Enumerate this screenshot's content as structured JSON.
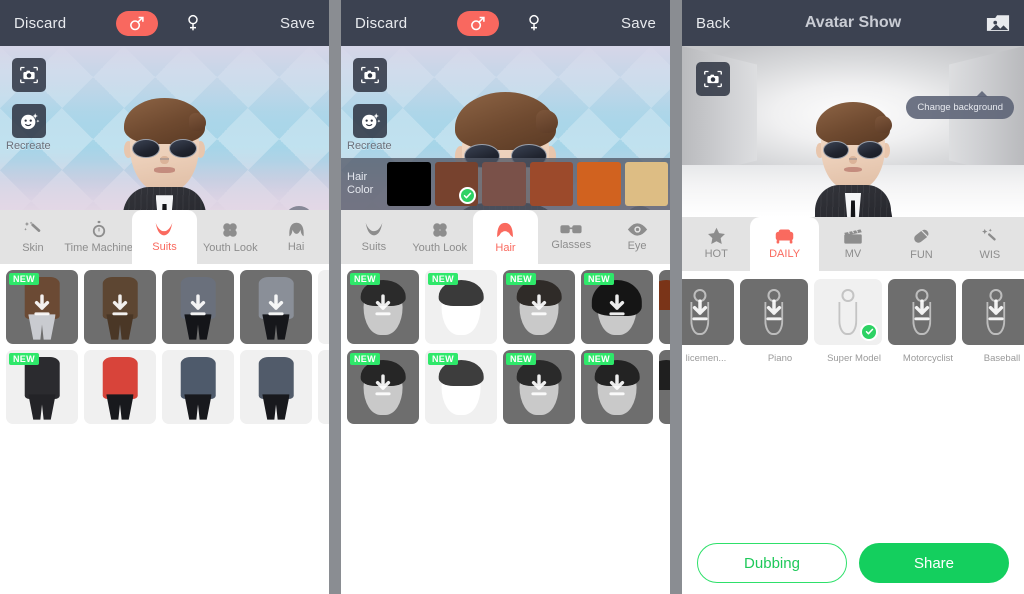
{
  "panel1": {
    "header": {
      "discard": "Discard",
      "save": "Save",
      "male_icon": "male-symbol-icon",
      "female_icon": "female-symbol-icon",
      "male_selected": true,
      "accent": "#f9685f"
    },
    "stage": {
      "camera_icon": "camera-icon",
      "recreate_icon": "face-sparkle-icon",
      "recreate_label": "Recreate",
      "zoom_in": "+",
      "zoom_out": "−",
      "background": "argyle-light-blue"
    },
    "tabs": [
      {
        "label": "Skin",
        "icon": "magic-wand-icon",
        "active": false
      },
      {
        "label": "Time Machine",
        "icon": "stopwatch-icon",
        "active": false
      },
      {
        "label": "Suits",
        "icon": "suit-icon",
        "active": true
      },
      {
        "label": "Youth Look",
        "icon": "clover-icon",
        "active": false
      },
      {
        "label": "Hai",
        "icon": "hair-icon",
        "active": false
      }
    ],
    "grid_rows": [
      [
        {
          "badge": "NEW",
          "dark": true,
          "download": true,
          "color": "#6b4a34"
        },
        {
          "badge": "",
          "dark": true,
          "download": true,
          "color": "#5d4632"
        },
        {
          "badge": "",
          "dark": true,
          "download": true,
          "color": "#6a707c"
        },
        {
          "badge": "",
          "dark": true,
          "download": true,
          "color": "#8a8f98"
        },
        {
          "badge": "",
          "dark": true,
          "download": true,
          "color": "#7b7f88"
        }
      ],
      [
        {
          "badge": "NEW",
          "dark": false,
          "download": false,
          "color": "#2b2b2f"
        },
        {
          "badge": "",
          "dark": false,
          "download": false,
          "color": "#d8443a"
        },
        {
          "badge": "",
          "dark": false,
          "download": false,
          "color": "#4e5a6b"
        },
        {
          "badge": "",
          "dark": false,
          "download": false,
          "color": "#515b6a"
        },
        {
          "badge": "",
          "dark": false,
          "download": false,
          "color": "#4a5565"
        }
      ]
    ]
  },
  "panel2": {
    "header": {
      "discard": "Discard",
      "save": "Save",
      "male_icon": "male-symbol-icon",
      "female_icon": "female-symbol-icon",
      "male_selected": true,
      "accent": "#f9685f"
    },
    "stage": {
      "camera_icon": "camera-icon",
      "recreate_icon": "face-sparkle-icon",
      "recreate_label": "Recreate",
      "zoom_in": "+",
      "zoom_out": "−",
      "background": "argyle-light-blue"
    },
    "hair_color": {
      "label": "Hair\nColor",
      "label_line1": "Hair",
      "label_line2": "Color",
      "swatches": [
        {
          "color": "#000000",
          "selected": false
        },
        {
          "color": "#77422e",
          "selected": true
        },
        {
          "color": "#7a5149",
          "selected": false
        },
        {
          "color": "#9c4a2b",
          "selected": false
        },
        {
          "color": "#d1621f",
          "selected": false
        },
        {
          "color": "#ddbd84",
          "selected": false
        }
      ],
      "check_color": "#2dd264"
    },
    "tabs": [
      {
        "label": "Suits",
        "icon": "suit-icon",
        "active": false
      },
      {
        "label": "Youth Look",
        "icon": "clover-icon",
        "active": false
      },
      {
        "label": "Hair",
        "icon": "hair-icon",
        "active": true
      },
      {
        "label": "Glasses",
        "icon": "glasses-icon",
        "active": false
      },
      {
        "label": "Eye",
        "icon": "eye-icon",
        "active": false
      }
    ],
    "grid_rows": [
      [
        {
          "badge": "NEW",
          "dark": true,
          "download": true,
          "color": "#2b2b2b"
        },
        {
          "badge": "NEW",
          "dark": false,
          "download": false,
          "color": "#3a3a3a"
        },
        {
          "badge": "NEW",
          "dark": true,
          "download": true,
          "color": "#2f2b28"
        },
        {
          "badge": "NEW",
          "dark": true,
          "download": true,
          "color": "#151515"
        },
        {
          "badge": "",
          "dark": true,
          "download": false,
          "color": "#7a3418"
        }
      ],
      [
        {
          "badge": "NEW",
          "dark": true,
          "download": true,
          "color": "#262626"
        },
        {
          "badge": "NEW",
          "dark": false,
          "download": false,
          "color": "#3d3d3d"
        },
        {
          "badge": "NEW",
          "dark": true,
          "download": true,
          "color": "#2a2a2a"
        },
        {
          "badge": "NEW",
          "dark": true,
          "download": true,
          "color": "#232323"
        },
        {
          "badge": "",
          "dark": true,
          "download": false,
          "color": "#1f1f1f"
        }
      ]
    ]
  },
  "panel3": {
    "header": {
      "back": "Back",
      "title": "Avatar Show",
      "photo_icon": "photo-picture-icon"
    },
    "stage": {
      "camera_icon": "camera-icon",
      "tooltip": "Change background",
      "background": "grey-runway"
    },
    "tabs": [
      {
        "label": "HOT",
        "icon": "star-icon",
        "active": false
      },
      {
        "label": "DAILY",
        "icon": "sofa-icon",
        "active": true
      },
      {
        "label": "MV",
        "icon": "clapperboard-icon",
        "active": false
      },
      {
        "label": "FUN",
        "icon": "capsule-icon",
        "active": false
      },
      {
        "label": "WIS",
        "icon": "wish-sparkle-icon",
        "active": false
      }
    ],
    "items": [
      {
        "label": "licemen...",
        "dark": true,
        "download": true,
        "selected": false
      },
      {
        "label": "Piano",
        "dark": true,
        "download": true,
        "selected": false
      },
      {
        "label": "Super Model",
        "dark": false,
        "download": false,
        "selected": true
      },
      {
        "label": "Motorcyclist",
        "dark": true,
        "download": true,
        "selected": false
      },
      {
        "label": "Baseball",
        "dark": true,
        "download": true,
        "selected": false
      }
    ],
    "actions": {
      "dubbing": "Dubbing",
      "share": "Share",
      "dubbing_color": "#1fc95a",
      "share_bg": "#14cf5e"
    }
  }
}
